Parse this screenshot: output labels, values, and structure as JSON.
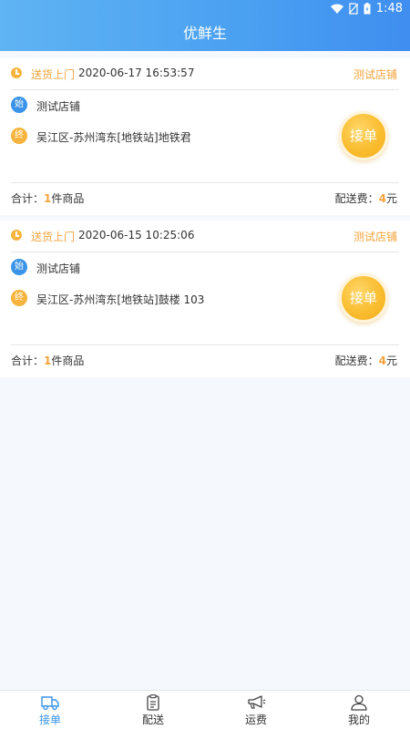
{
  "status_bar": {
    "time": "1:48"
  },
  "header": {
    "title": "优鲜生"
  },
  "orders": [
    {
      "delivery_type": "送货上门",
      "time": "2020-06-17 16:53:57",
      "shop_link": "测试店铺",
      "start_badge": "始",
      "start": "测试店铺",
      "end_badge": "终",
      "end": "吴江区-苏州湾东[地铁站]地铁君",
      "accept_label": "接单",
      "total_prefix": "合计：",
      "total_count": "1",
      "total_suffix": "件商品",
      "fee_prefix": "配送费：",
      "fee_value": "4",
      "fee_unit": "元"
    },
    {
      "delivery_type": "送货上门",
      "time": "2020-06-15 10:25:06",
      "shop_link": "测试店铺",
      "start_badge": "始",
      "start": "测试店铺",
      "end_badge": "终",
      "end": "吴江区-苏州湾东[地铁站]鼓楼 103",
      "accept_label": "接单",
      "total_prefix": "合计：",
      "total_count": "1",
      "total_suffix": "件商品",
      "fee_prefix": "配送费：",
      "fee_value": "4",
      "fee_unit": "元"
    }
  ],
  "tabs": [
    {
      "label": "接单",
      "icon": "truck-icon",
      "active": true
    },
    {
      "label": "配送",
      "icon": "clipboard-icon",
      "active": false
    },
    {
      "label": "运费",
      "icon": "megaphone-icon",
      "active": false
    },
    {
      "label": "我的",
      "icon": "person-icon",
      "active": false
    }
  ],
  "colors": {
    "primary": "#3a93e8",
    "accent": "#f2a33a"
  }
}
